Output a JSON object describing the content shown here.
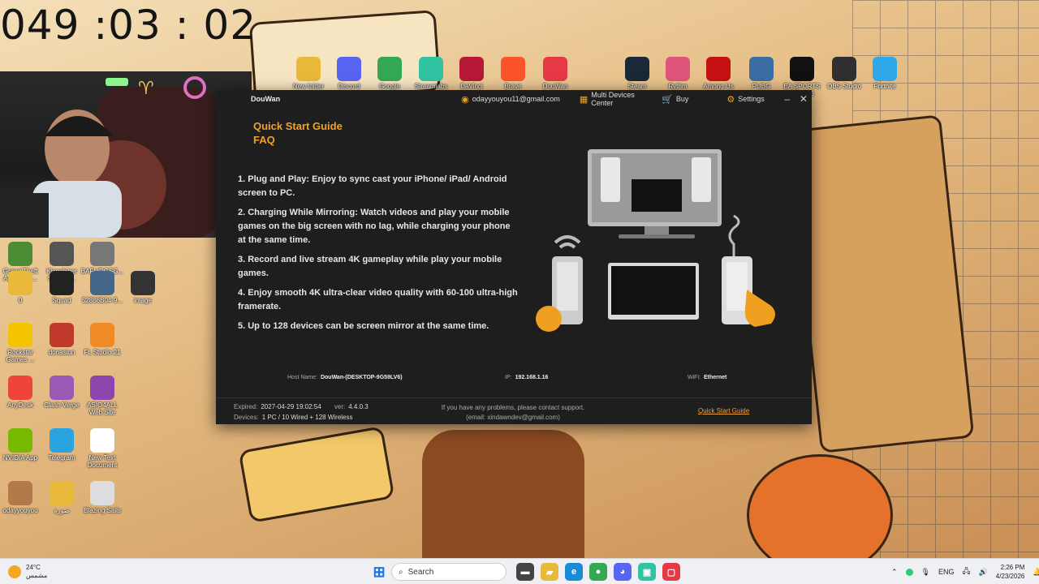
{
  "timer": "049 :03 : 02",
  "desktop_icons_top": [
    {
      "label": "New folder",
      "icon": "folder-icon",
      "color": "#e8b93a"
    },
    {
      "label": "Discord",
      "icon": "discord-icon",
      "color": "#5865f2"
    },
    {
      "label": "Google",
      "icon": "chrome-icon",
      "color": "#34a853"
    },
    {
      "label": "Streamlabs",
      "icon": "streamlabs-icon",
      "color": "#31c3a2"
    },
    {
      "label": "DaVinci",
      "icon": "app-icon",
      "color": "#b51935"
    },
    {
      "label": "Brave",
      "icon": "brave-icon",
      "color": "#fb542b"
    },
    {
      "label": "DouWan",
      "icon": "douwan-icon",
      "color": "#e53945"
    },
    {
      "label": "Steam",
      "icon": "steam-icon",
      "color": "#1b2838"
    },
    {
      "label": "Rythm",
      "icon": "app-icon",
      "color": "#e0557a"
    },
    {
      "label": "Among Us",
      "icon": "among-us-icon",
      "color": "#c51111"
    },
    {
      "label": "PUBG",
      "icon": "pubg-icon",
      "color": "#3a6ea5"
    },
    {
      "label": "EA SPORTS FC™ 26",
      "icon": "ea-fc-icon",
      "color": "#111111"
    },
    {
      "label": "OBS Studio",
      "icon": "obs-icon",
      "color": "#302e31"
    },
    {
      "label": "Fortnite",
      "icon": "fortnite-icon",
      "color": "#2ea8e6"
    }
  ],
  "desktop_icons_left": [
    {
      "label": "Grand Theft Auto V Le...",
      "icon": "gta-icon",
      "color": "#4b8c34"
    },
    {
      "label": "Kingshiper Screen ...",
      "icon": "app-icon",
      "color": "#555555"
    },
    {
      "label": "BAFLIDGSG...",
      "icon": "file-icon",
      "color": "#777777"
    },
    {
      "label": "0",
      "icon": "folder-icon",
      "color": "#e8b93a"
    },
    {
      "label": "Squad",
      "icon": "squad-icon",
      "color": "#222222"
    },
    {
      "label": "52886B04-9...",
      "icon": "image-icon",
      "color": "#446688"
    },
    {
      "label": "image",
      "icon": "image-icon",
      "color": "#333333"
    },
    {
      "label": "Rockstar Games ...",
      "icon": "rockstar-icon",
      "color": "#f5c400"
    },
    {
      "label": "donasiun",
      "icon": "file-icon",
      "color": "#c0392b"
    },
    {
      "label": "FL Studio 21",
      "icon": "fl-studio-icon",
      "color": "#f08a24"
    },
    {
      "label": "AnyDesk",
      "icon": "anydesk-icon",
      "color": "#ef443b"
    },
    {
      "label": "Clash Verge",
      "icon": "clash-icon",
      "color": "#9b59b6"
    },
    {
      "label": "ASIO4ALL Web Site",
      "icon": "asio-icon",
      "color": "#8e44ad"
    },
    {
      "label": "NVIDIA App",
      "icon": "nvidia-icon",
      "color": "#76b900"
    },
    {
      "label": "Telegram",
      "icon": "telegram-icon",
      "color": "#2aa3df"
    },
    {
      "label": "New Text Document",
      "icon": "text-file-icon",
      "color": "#ffffff"
    },
    {
      "label": "odayyouyou",
      "icon": "image-icon",
      "color": "#b07a4a"
    },
    {
      "label": "صورة",
      "icon": "folder-icon",
      "color": "#e8b93a"
    },
    {
      "label": "Blazing Sails",
      "icon": "game-icon",
      "color": "#dddddd"
    }
  ],
  "app": {
    "title": "DouWan",
    "user_email": "odayyouyou11@gmail.com",
    "multi_devices": "Multi Devices Center",
    "buy": "Buy",
    "settings": "Settings",
    "quick_start": "Quick Start Guide",
    "faq": "FAQ",
    "features": [
      "1. Plug and Play: Enjoy to sync cast your iPhone/ iPad/ Android screen to PC.",
      "2. Charging While Mirroring: Watch videos and play your mobile games on the big screen with no lag, while charging your phone at the same time.",
      "3. Record and live stream 4K gameplay while play your mobile games.",
      "4. Enjoy smooth 4K ultra-clear video quality with 60-100 ultra-high framerate.",
      "5. Up to 128 devices can be screen mirror at the same time."
    ],
    "host_label": "Host Name:",
    "host_value": "DouWan-(DESKTOP-9G59LV6)",
    "ip_label": "IP:",
    "ip_value": "192.168.1.16",
    "wifi_label": "WiFi:",
    "wifi_value": "Ethernet",
    "expired_label": "Expired:",
    "expired_value": "2027-04-29 19:02:54",
    "version_label": "ver:",
    "version_value": "4.4.0.3",
    "devices_label": "Devices:",
    "devices_value": "1 PC / 10 Wired + 128 Wireless",
    "support_line1": "If you have any problems, please contact support.",
    "support_line2": "(email: xindawndev@gmail.com)",
    "footer_link": "Quick Start Guide"
  },
  "taskbar": {
    "weather_temp": "24°C",
    "weather_desc": "مشمس",
    "search_placeholder": "Search",
    "language": "ENG",
    "time": "2:26 PM",
    "date": "4/23/2026",
    "apps": [
      {
        "icon": "file-explorer-icon",
        "color": "#444444",
        "glyph": "▬"
      },
      {
        "icon": "folder-icon",
        "color": "#e8b93a",
        "glyph": "▰"
      },
      {
        "icon": "edge-icon",
        "color": "#1a8bd6",
        "glyph": "e"
      },
      {
        "icon": "chrome-icon",
        "color": "#34a853",
        "glyph": "●"
      },
      {
        "icon": "discord-icon",
        "color": "#5865f2",
        "glyph": "◕"
      },
      {
        "icon": "streamlabs-icon",
        "color": "#31c3a2",
        "glyph": "▣"
      },
      {
        "icon": "douwan-icon",
        "color": "#e53945",
        "glyph": "▢"
      }
    ]
  },
  "colors": {
    "accent": "#f2a12a",
    "app_bg": "#1e1e1e",
    "taskbar": "#eef0f4"
  }
}
